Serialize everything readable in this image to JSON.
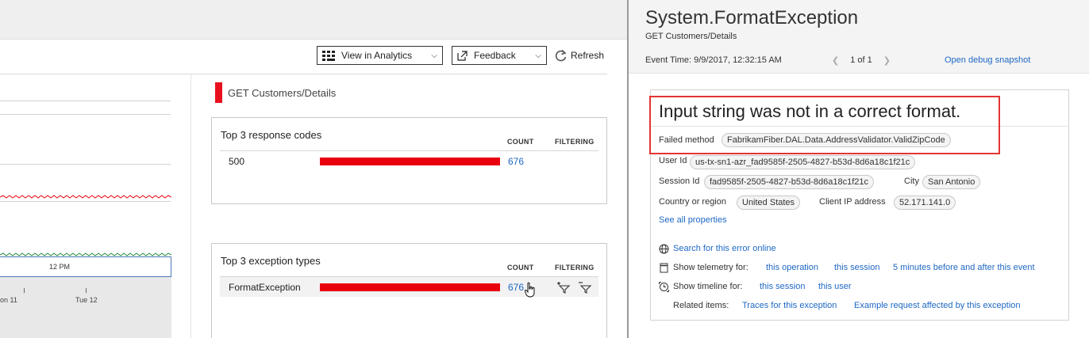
{
  "toolbar": {
    "analytics_label": "View in Analytics",
    "feedback_label": "Feedback",
    "refresh_label": "Refresh"
  },
  "chart": {
    "timebar_label": "12 PM",
    "x_ticks": [
      "on 11",
      "Tue 12"
    ]
  },
  "operation": {
    "name": "GET Customers/Details"
  },
  "response_codes": {
    "title": "Top 3 response codes",
    "count_header": "COUNT",
    "filter_header": "FILTERING",
    "rows": [
      {
        "name": "500",
        "count": "676",
        "fill": 1.0
      }
    ]
  },
  "exception_types": {
    "title": "Top 3 exception types",
    "count_header": "COUNT",
    "filter_header": "FILTERING",
    "rows": [
      {
        "name": "FormatException",
        "count": "676",
        "fill": 1.0
      }
    ]
  },
  "blade": {
    "title": "System.FormatException",
    "subtitle": "GET Customers/Details",
    "event_time": "Event Time: 9/9/2017, 12:32:15 AM",
    "pager": "1 of 1",
    "debug_link": "Open debug snapshot",
    "message": "Input string was not in a correct format.",
    "failed_method_label": "Failed method",
    "failed_method": "FabrikamFiber.DAL.Data.AddressValidator.ValidZipCode",
    "user_id_label": "User Id",
    "user_id": "us-tx-sn1-azr_fad9585f-2505-4827-b53d-8d6a18c1f21c",
    "session_id_label": "Session Id",
    "session_id": "fad9585f-2505-4827-b53d-8d6a18c1f21c",
    "city_label": "City",
    "city": "San Antonio",
    "country_label": "Country or region",
    "country": "United States",
    "client_ip_label": "Client IP address",
    "client_ip": "52.171.141.0",
    "see_all": "See all properties",
    "search_error": "Search for this error online",
    "show_telemetry_label": "Show telemetry for:",
    "telemetry_links": [
      "this operation",
      "this session",
      "5 minutes before and after this event"
    ],
    "show_timeline_label": "Show timeline for:",
    "timeline_links": [
      "this session",
      "this user"
    ],
    "related_label": "Related items:",
    "related_links": [
      "Traces for this exception",
      "Example request affected by this exception"
    ]
  },
  "colors": {
    "accent_red": "#e8000f",
    "link_blue": "#1e68c4",
    "highlight_border": "#e33434"
  }
}
